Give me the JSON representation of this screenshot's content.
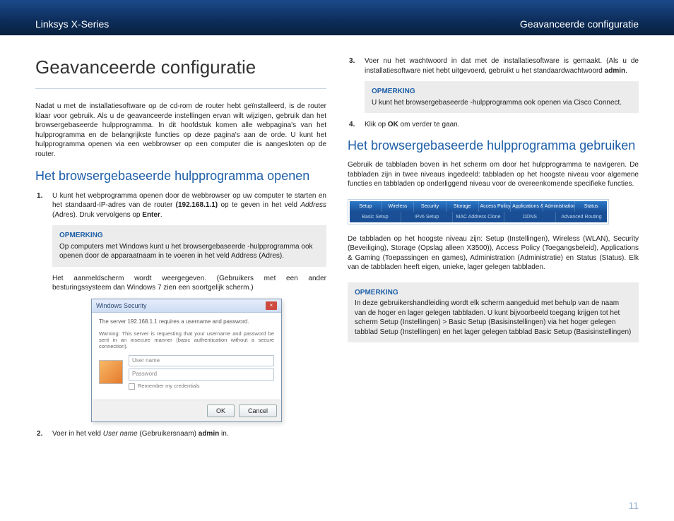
{
  "header": {
    "left": "Linksys X-Series",
    "right": "Geavanceerde configuratie"
  },
  "page_number": "11",
  "left_column": {
    "title": "Geavanceerde configuratie",
    "intro": "Nadat u met de installatiesoftware op de cd-rom de router hebt geïnstalleerd, is de router klaar voor gebruik. Als u de geavanceerde instellingen ervan wilt wijzigen, gebruik dan het browsergebaseerde hulpprogramma. In dit hoofdstuk komen alle webpagina's van het hulpprogramma en de belangrijkste functies op deze pagina's aan de orde. U kunt het hulpprogramma openen via een webbrowser op een computer die is aangesloten op de router.",
    "section1_heading": "Het browsergebaseerde hulpprogramma openen",
    "step1_pre": "U kunt het webprogramma openen door de webbrowser op uw computer te starten en het standaard-IP-adres van de router ",
    "step1_ip": "(192.168.1.1)",
    "step1_mid": " op te geven in het veld ",
    "step1_addr": "Address",
    "step1_addr_paren": " (Adres). Druk vervolgens op ",
    "step1_enter": "Enter",
    "step1_end": ".",
    "note1_title": "OPMERKING",
    "note1_body": "Op computers met Windows kunt u het browsergebaseerde -hulpprogramma ook openen door de apparaatnaam in te voeren in het veld Address (Adres).",
    "after_note1": "Het aanmeldscherm wordt weergegeven. (Gebruikers met een ander besturingssysteem dan Windows 7 zien een soortgelijk scherm.)",
    "dialog": {
      "title": "Windows Security",
      "line1": "The server 192.168.1.1 requires a username and password.",
      "warn": "Warning: This server is requesting that your username and password be sent in an insecure manner (basic authentication without a secure connection).",
      "user_placeholder": "User name",
      "pass_placeholder": "Password",
      "remember": "Remember my credentials",
      "ok": "OK",
      "cancel": "Cancel"
    },
    "step2_pre": "Voer in het veld ",
    "step2_field": "User name",
    "step2_paren": " (Gebruikersnaam) ",
    "step2_val": "admin",
    "step2_end": " in."
  },
  "right_column": {
    "step3": "Voer nu het wachtwoord in dat met de installatiesoftware is gemaakt. (Als u de installatiesoftware niet hebt uitgevoerd, gebruikt u het standaardwachtwoord ",
    "step3_bold": "admin",
    "step3_end": ".",
    "note2_title": "OPMERKING",
    "note2_body": "U kunt het browsergebaseerde -hulpprogramma ook openen via Cisco Connect.",
    "step4_pre": "Klik op ",
    "step4_bold": "OK",
    "step4_end": " om verder te gaan.",
    "section2_heading": "Het browsergebaseerde hulpprogramma gebruiken",
    "para1": "Gebruik de tabbladen boven in het scherm om door het hulpprogramma te navigeren. De tabbladen zijn in twee niveaus ingedeeld: tabbladen op het hoogste niveau voor algemene functies en tabbladen op onderliggend niveau voor de overeenkomende specifieke functies.",
    "tabs_top": [
      "Setup",
      "Wireless",
      "Security",
      "Storage",
      "Access Policy",
      "Applications & Gaming",
      "Administration",
      "Status"
    ],
    "tabs_bottom": [
      "Basic Setup",
      "IPv6 Setup",
      "MAC Address Clone",
      "DDNS",
      "Advanced Routing"
    ],
    "para2": "De tabbladen op het hoogste niveau zijn: Setup (Instellingen), Wireless (WLAN), Security (Beveiliging), Storage (Opslag alleen X3500)), Access Policy (Toegangsbeleid), Applications & Gaming (Toepassingen en games), Administration (Administratie) en Status (Status). Elk van de tabbladen heeft eigen, unieke, lager gelegen tabbladen.",
    "note3_title": "OPMERKING",
    "note3_body": "In deze gebruikershandleiding wordt elk scherm aangeduid met behulp van de naam van de hoger en lager gelegen tabbladen. U kunt bijvoorbeeld toegang krijgen tot het scherm Setup (Instellingen) > Basic Setup (Basisinstellingen) via het hoger gelegen tabblad Setup (Instellingen) en het lager gelegen tabblad Basic Setup (Basisinstellingen)"
  }
}
